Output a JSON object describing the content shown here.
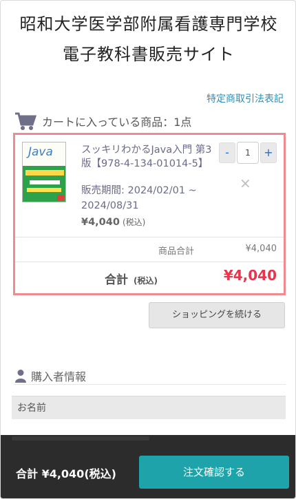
{
  "site": {
    "title_line1": "昭和大学医学部附属看護専門学校",
    "title_line2": "電子教科書販売サイト"
  },
  "legal_link": "特定商取引法表記",
  "cart": {
    "heading": "カートに入っている商品：1点",
    "item": {
      "name": "スッキリわかるJava入門 第3版【978-4-134-01014-5】",
      "period": "販売期間: 2024/02/01 ~ 2024/08/31",
      "price": "¥4,040",
      "price_tax_note": "(税込)",
      "quantity": "1",
      "minus_label": "-",
      "plus_label": "+",
      "remove_label": "×",
      "cover_title": "Java"
    },
    "subtotal_label": "商品合計",
    "subtotal_value": "¥4,040",
    "total_label": "合計",
    "total_tax_note": "(税込)",
    "total_value": "¥4,040"
  },
  "continue_button": "ショッピングを続ける",
  "buyer": {
    "heading": "購入者情報",
    "name_label": "お名前"
  },
  "footer": {
    "total_text": "合計 ¥4,040(税込)",
    "order_button": "注文確認する"
  },
  "colors": {
    "accent": "#1fa3aa",
    "total_red": "#e8344c",
    "link": "#2a8fbd",
    "cart_border": "#f08a8f"
  }
}
